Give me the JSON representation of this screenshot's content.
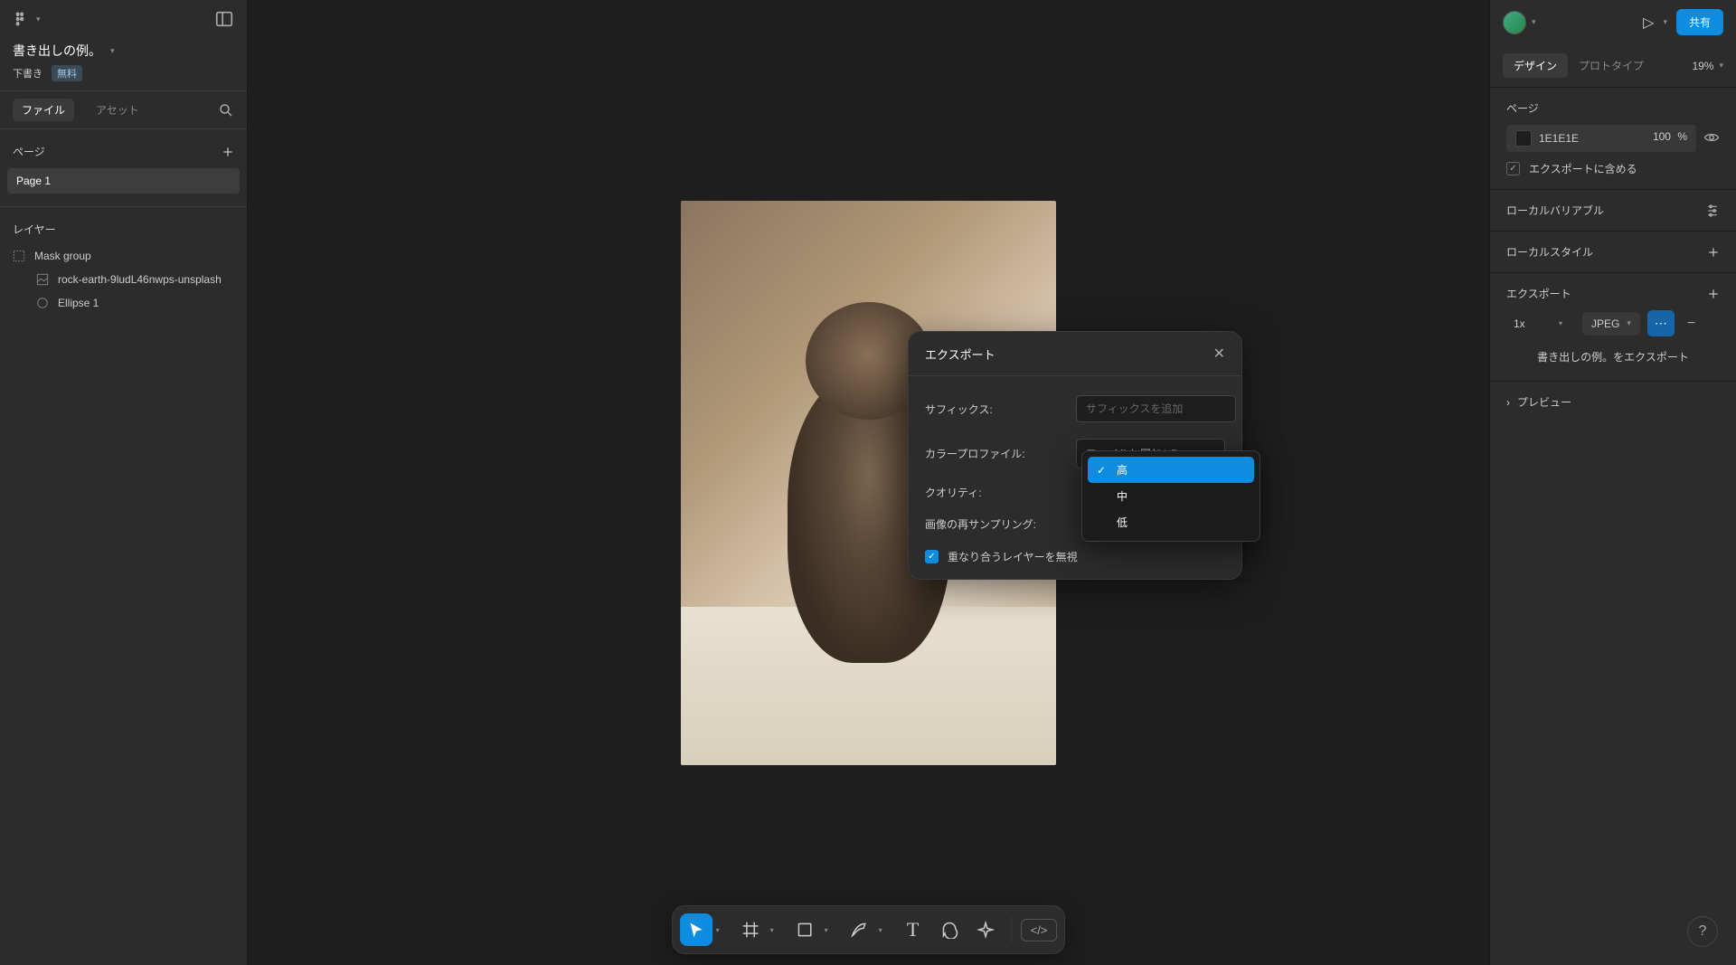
{
  "file": {
    "title": "書き出しの例。",
    "draft": "下書き",
    "free_badge": "無料"
  },
  "sidebar_tabs": {
    "file": "ファイル",
    "assets": "アセット"
  },
  "pages": {
    "header": "ページ",
    "items": [
      "Page 1"
    ]
  },
  "layers": {
    "header": "レイヤー",
    "items": [
      {
        "name": "Mask group",
        "type": "mask",
        "indent": 0
      },
      {
        "name": "rock-earth-9ludL46nwps-unsplash",
        "type": "image",
        "indent": 1
      },
      {
        "name": "Ellipse 1",
        "type": "ellipse",
        "indent": 1
      }
    ]
  },
  "export_dialog": {
    "title": "エクスポート",
    "suffix_label": "サフィックス:",
    "suffix_placeholder": "サフィックスを追加",
    "color_profile_label": "カラープロファイル:",
    "color_profile_value": "ファイルと同じ(sR...",
    "quality_label": "クオリティ:",
    "resampling_label": "画像の再サンプリング:",
    "ignore_overlap_label": "重なり合うレイヤーを無視"
  },
  "quality_options": {
    "high": "高",
    "medium": "中",
    "low": "低"
  },
  "top_right": {
    "share": "共有"
  },
  "design_tabs": {
    "design": "デザイン",
    "prototype": "プロトタイプ",
    "zoom": "19%"
  },
  "page_panel": {
    "title": "ページ",
    "color_hex": "1E1E1E",
    "opacity_value": "100",
    "opacity_unit": "%",
    "include_label": "エクスポートに含める"
  },
  "variables_panel": {
    "title": "ローカルバリアブル"
  },
  "styles_panel": {
    "title": "ローカルスタイル"
  },
  "export_panel": {
    "title": "エクスポート",
    "scale": "1x",
    "format": "JPEG",
    "export_button": "書き出しの例。をエクスポート",
    "preview": "プレビュー"
  }
}
